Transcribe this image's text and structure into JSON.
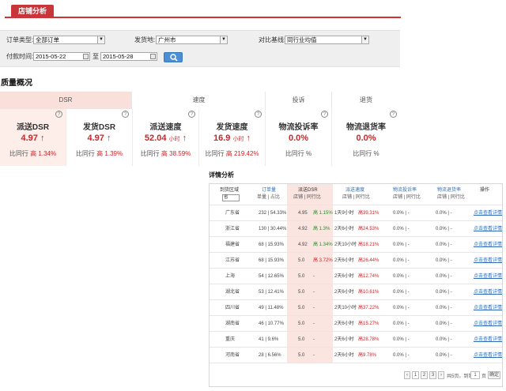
{
  "header": {
    "tab_label": "店铺分析"
  },
  "filter": {
    "order_type_label": "订单类型:",
    "order_type_value": "全部订单",
    "ship_from_label": "发货地:",
    "ship_from_value": "广州市",
    "compare_label": "对比基线:",
    "compare_value": "同行业均值",
    "pay_time_label": "付款时间:",
    "date_from": "2015-05-22",
    "date_sep": "至",
    "date_to": "2015-05-28"
  },
  "quality": {
    "title": "质量概况",
    "groups": [
      "DSR",
      "速度",
      "投诉",
      "退货"
    ],
    "help_glyph": "?",
    "metrics": [
      {
        "name": "派送DSR",
        "value": "4.97",
        "unit": "",
        "arrow": "↑",
        "cmp_label": "比同行",
        "cmp_dir": "高",
        "cmp_val": "1.34%"
      },
      {
        "name": "发货DSR",
        "value": "4.97",
        "unit": "",
        "arrow": "↑",
        "cmp_label": "比同行",
        "cmp_dir": "高",
        "cmp_val": "1.39%"
      },
      {
        "name": "派送速度",
        "value": "52.04",
        "unit": "小时",
        "arrow": "↑",
        "cmp_label": "比同行",
        "cmp_dir": "高",
        "cmp_val": "38.59%"
      },
      {
        "name": "发货速度",
        "value": "16.9",
        "unit": "小时",
        "arrow": "↑",
        "cmp_label": "比同行",
        "cmp_dir": "高",
        "cmp_val": "219.42%"
      },
      {
        "name": "物流投诉率",
        "value": "0.0%",
        "unit": "",
        "arrow": "",
        "cmp_label": "比同行",
        "cmp_dir": "",
        "cmp_val": "%"
      },
      {
        "name": "物流退货率",
        "value": "0.0%",
        "unit": "",
        "arrow": "",
        "cmp_label": "比同行",
        "cmp_dir": "",
        "cmp_val": "%"
      }
    ]
  },
  "detail": {
    "title": "详情分析",
    "head": {
      "region": "到货区域",
      "region_select": "省",
      "orders": "订单量",
      "orders_sub": "单量 | 占比",
      "dsr": "派送DSR",
      "dsr_sub": "店铺 | 同行比",
      "speed": "派送速度",
      "speed_sub": "店铺 | 同行比",
      "complaint": "物流投诉率",
      "complaint_sub": "店铺 | 同行比",
      "return": "物流退货率",
      "return_sub": "店铺 | 同行比",
      "action": "操作"
    },
    "rows": [
      {
        "prov": "广东省",
        "orders": "232 | 54.33%",
        "dsr": "4.95",
        "dsr_cmp": "高 1.15%",
        "dsr_tone": "lo",
        "speed": "1天9小时",
        "speed_cmp": "高39.31%",
        "complaint": "0.0% | -",
        "ret": "0.0% | -",
        "action": "点击查看详情"
      },
      {
        "prov": "浙江省",
        "orders": "130 | 30.44%",
        "dsr": "4.92",
        "dsr_cmp": "高 1.3%",
        "dsr_tone": "lo",
        "speed": "2天6小时",
        "speed_cmp": "高24.53%",
        "complaint": "0.0% | -",
        "ret": "0.0% | -",
        "action": "点击查看详情"
      },
      {
        "prov": "福建省",
        "orders": "68 | 15.93%",
        "dsr": "4.92",
        "dsr_cmp": "高 1.34%",
        "dsr_tone": "lo",
        "speed": "2天10小时",
        "speed_cmp": "高18.21%",
        "complaint": "0.0% | -",
        "ret": "0.0% | -",
        "action": "点击查看详情"
      },
      {
        "prov": "江苏省",
        "orders": "68 | 15.93%",
        "dsr": "5.0",
        "dsr_cmp": "高 3.72%",
        "dsr_tone": "hi",
        "speed": "2天6小时",
        "speed_cmp": "高26.44%",
        "complaint": "0.0% | -",
        "ret": "0.0% | -",
        "action": "点击查看详情"
      },
      {
        "prov": "上海",
        "orders": "54 | 12.65%",
        "dsr": "5.0",
        "dsr_cmp": "-",
        "dsr_tone": "",
        "speed": "2天6小时",
        "speed_cmp": "高12.74%",
        "complaint": "0.0% | -",
        "ret": "0.0% | -",
        "action": "点击查看详情"
      },
      {
        "prov": "湖北省",
        "orders": "53 | 12.41%",
        "dsr": "5.0",
        "dsr_cmp": "-",
        "dsr_tone": "",
        "speed": "2天6小时",
        "speed_cmp": "高10.61%",
        "complaint": "0.0% | -",
        "ret": "0.0% | -",
        "action": "点击查看详情"
      },
      {
        "prov": "四川省",
        "orders": "49 | 11.48%",
        "dsr": "5.0",
        "dsr_cmp": "-",
        "dsr_tone": "",
        "speed": "2天10小时",
        "speed_cmp": "高37.22%",
        "complaint": "0.0% | -",
        "ret": "0.0% | -",
        "action": "点击查看详情"
      },
      {
        "prov": "湖南省",
        "orders": "46 | 10.77%",
        "dsr": "5.0",
        "dsr_cmp": "-",
        "dsr_tone": "",
        "speed": "2天6小时",
        "speed_cmp": "高15.27%",
        "complaint": "0.0% | -",
        "ret": "0.0% | -",
        "action": "点击查看详情"
      },
      {
        "prov": "重庆",
        "orders": "41 | 9.6%",
        "dsr": "5.0",
        "dsr_cmp": "-",
        "dsr_tone": "",
        "speed": "2天6小时",
        "speed_cmp": "高28.78%",
        "complaint": "0.0% | -",
        "ret": "0.0% | -",
        "action": "点击查看详情"
      },
      {
        "prov": "河南省",
        "orders": "28 | 6.56%",
        "dsr": "5.0",
        "dsr_cmp": "-",
        "dsr_tone": "",
        "speed": "2天6小时",
        "speed_cmp": "高9.78%",
        "complaint": "0.0% | -",
        "ret": "0.0% | -",
        "action": "点击查看详情"
      }
    ],
    "pager": {
      "page1": "1",
      "page2": "2",
      "page3": "3",
      "total_text": "共5页，到第",
      "page_input": "1",
      "page_suffix": "页",
      "confirm": "确定"
    }
  }
}
